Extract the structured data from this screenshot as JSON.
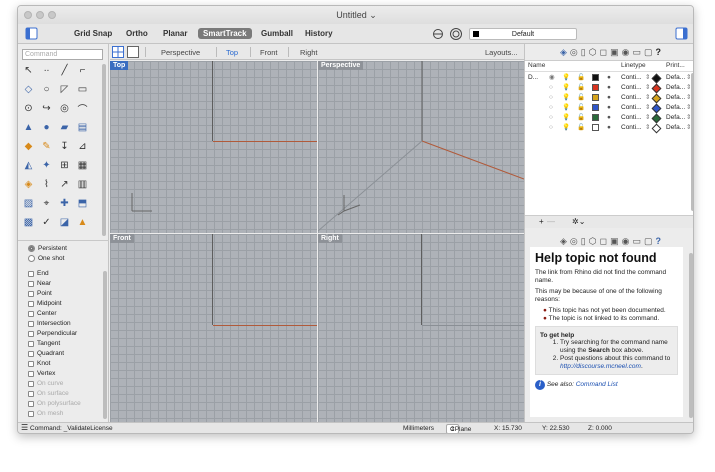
{
  "window": {
    "title": "Untitled"
  },
  "toolbar": {
    "items": [
      "Grid Snap",
      "Ortho",
      "Planar",
      "SmartTrack",
      "Gumball",
      "History"
    ],
    "layer": "Default"
  },
  "left": {
    "command_placeholder": "Command"
  },
  "viewport_tabs": {
    "items": [
      "Perspective",
      "Top",
      "Front",
      "Right"
    ],
    "layouts": "Layouts..."
  },
  "viewports": {
    "top": "Top",
    "perspective": "Perspective",
    "front": "Front",
    "right": "Right"
  },
  "osnap": {
    "modes": [
      "Persistent",
      "One shot"
    ],
    "items": [
      "End",
      "Near",
      "Point",
      "Midpoint",
      "Center",
      "Intersection",
      "Perpendicular",
      "Tangent",
      "Quadrant",
      "Knot",
      "Vertex",
      "On curve",
      "On surface",
      "On polysurface",
      "On mesh"
    ]
  },
  "layers": {
    "headers": {
      "name": "Name",
      "linetype": "Linetype",
      "print": "Print..."
    },
    "rows": [
      {
        "name": "D...",
        "color": "#111111",
        "linetype": "Conti...",
        "print": "Defa...",
        "pcolor": "#111111"
      },
      {
        "name": "",
        "color": "#d8341f",
        "linetype": "Conti...",
        "print": "Defa...",
        "pcolor": "#d8341f"
      },
      {
        "name": "",
        "color": "#d6a41c",
        "linetype": "Conti...",
        "print": "Defa...",
        "pcolor": "#d6a41c"
      },
      {
        "name": "",
        "color": "#2f56c8",
        "linetype": "Conti...",
        "print": "Defa...",
        "pcolor": "#2f56c8"
      },
      {
        "name": "",
        "color": "#2a6a3a",
        "linetype": "Conti...",
        "print": "Defa...",
        "pcolor": "#2a6a3a"
      },
      {
        "name": "",
        "color": "#ffffff",
        "linetype": "Conti...",
        "print": "Defa...",
        "pcolor": "#ffffff"
      }
    ]
  },
  "help": {
    "title": "Help topic not found",
    "p1": "The link from Rhino did not find the command name.",
    "p2": "This may be because of one of the following reasons:",
    "reasons": [
      "This topic has not yet been documented.",
      "The topic is not linked to its command."
    ],
    "to_get_help": "To get help",
    "step1a": "Try searching for the command name using the ",
    "step1b": "Search",
    "step1c": " box above.",
    "step2a": "Post questions about this command to ",
    "step2b": "http://discourse.mcneel.com",
    "step2c": ".",
    "see_also": "See also: ",
    "command_list": "Command List"
  },
  "status": {
    "command": "Command: _ValidateLicense",
    "units": "Millimeters",
    "cplane": "CPlane",
    "x": "X: 15.730",
    "y": "Y: 22.530",
    "z": "Z: 0.000"
  }
}
